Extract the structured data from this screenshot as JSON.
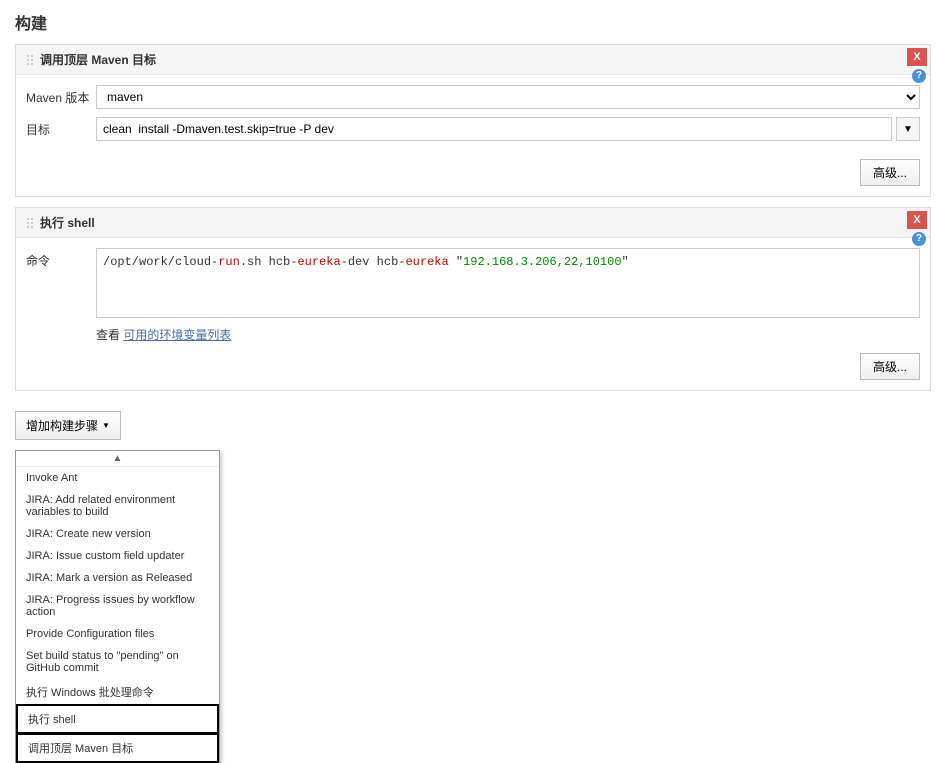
{
  "header": {
    "title": "构建"
  },
  "sections": {
    "maven": {
      "title": "调用顶层 Maven 目标",
      "fields": {
        "version": {
          "label": "Maven 版本",
          "value": "maven"
        },
        "goals": {
          "label": "目标",
          "value": "clean  install -Dmaven.test.skip=true -P dev"
        }
      },
      "advanced_label": "高级..."
    },
    "shell": {
      "title": "执行 shell",
      "fields": {
        "command": {
          "label": "命令",
          "text_prefix": "/opt/work/cloud-",
          "kw_run": "run",
          "text_mid1": ".sh hcb-",
          "kw_eureka1": "eureka",
          "text_mid2": "-dev hcb-",
          "kw_eureka2": "eureka",
          "text_mid3": " \"",
          "kw_ip": "192.168.3.206,22,10100",
          "text_suffix": "\""
        }
      },
      "env_link_prefix": "查看 ",
      "env_link": "可用的环境变量列表",
      "advanced_label": "高级..."
    }
  },
  "add_step": {
    "label": "增加构建步骤"
  },
  "dropdown": {
    "items": [
      "Invoke Ant",
      "JIRA: Add related environment variables to build",
      "JIRA: Create new version",
      "JIRA: Issue custom field updater",
      "JIRA: Mark a version as Released",
      "JIRA: Progress issues by workflow action",
      "Provide Configuration files",
      "Set build status to \"pending\" on GitHub commit",
      "执行 Windows 批处理命令",
      "执行 shell",
      "调用顶层 Maven 目标"
    ]
  }
}
